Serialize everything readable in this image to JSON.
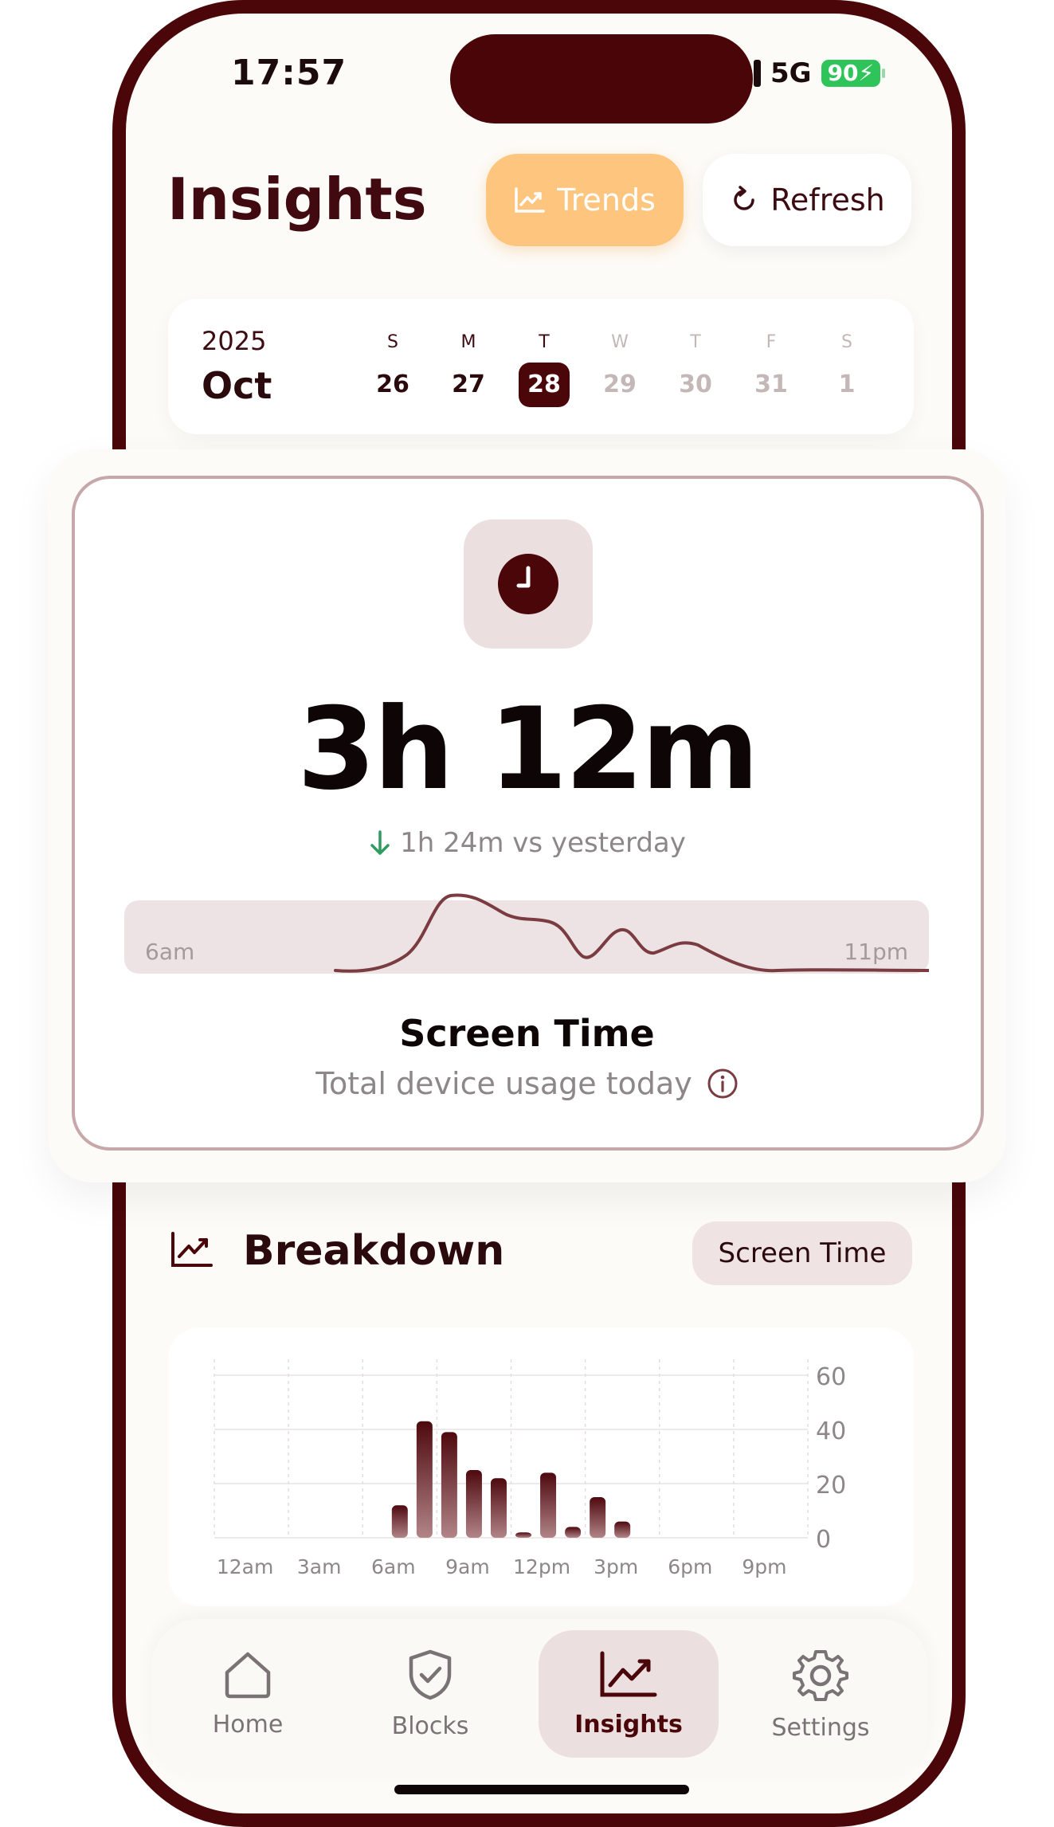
{
  "status_bar": {
    "time": "17:57",
    "network": "5G",
    "battery": "90"
  },
  "header": {
    "title": "Insights",
    "trends_label": "Trends",
    "refresh_label": "Refresh"
  },
  "calendar": {
    "year": "2025",
    "month": "Oct",
    "days": [
      {
        "letter": "S",
        "num": "26",
        "state": "past"
      },
      {
        "letter": "M",
        "num": "27",
        "state": "past"
      },
      {
        "letter": "T",
        "num": "28",
        "state": "selected"
      },
      {
        "letter": "W",
        "num": "29",
        "state": "future"
      },
      {
        "letter": "T",
        "num": "30",
        "state": "future"
      },
      {
        "letter": "F",
        "num": "31",
        "state": "future"
      },
      {
        "letter": "S",
        "num": "1",
        "state": "future"
      }
    ]
  },
  "summary": {
    "value": "3h 12m",
    "delta": "1h 24m vs yesterday",
    "range_start": "6am",
    "range_end": "11pm",
    "title": "Screen Time",
    "subtitle": "Total device usage today"
  },
  "breakdown": {
    "title": "Breakdown",
    "metric_pill": "Screen Time"
  },
  "chart_data": {
    "type": "bar",
    "x_tick_labels": [
      "12am",
      "3am",
      "6am",
      "9am",
      "12pm",
      "3pm",
      "6pm",
      "9pm"
    ],
    "y_ticks": [
      0,
      20,
      40,
      60
    ],
    "ylim": [
      0,
      60
    ],
    "categories": [
      "12am",
      "1am",
      "2am",
      "3am",
      "4am",
      "5am",
      "6am",
      "7am",
      "8am",
      "9am",
      "10am",
      "11am",
      "12pm",
      "1pm",
      "2pm",
      "3pm",
      "4pm",
      "5pm",
      "6pm",
      "7pm",
      "8pm",
      "9pm",
      "10pm",
      "11pm"
    ],
    "values": [
      0,
      0,
      0,
      0,
      0,
      0,
      0,
      12,
      43,
      39,
      25,
      22,
      2,
      24,
      4,
      15,
      6,
      0,
      0,
      0,
      0,
      0,
      0,
      0
    ],
    "grid": true
  },
  "tabs": [
    {
      "label": "Home",
      "icon": "home-icon"
    },
    {
      "label": "Blocks",
      "icon": "shield-check-icon"
    },
    {
      "label": "Insights",
      "icon": "chart-line-icon",
      "active": true
    },
    {
      "label": "Settings",
      "icon": "gear-icon"
    }
  ],
  "colors": {
    "accent": "#4a0609",
    "trends_button": "#fdc57d",
    "bar_top": "#4e090e",
    "bar_bottom": "#b18488",
    "battery": "#2fc45a"
  }
}
